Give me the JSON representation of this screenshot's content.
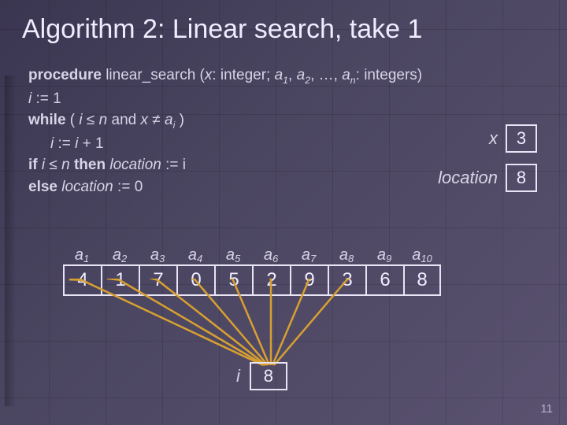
{
  "title": "Algorithm 2: Linear search, take 1",
  "code": {
    "l1_kw": "procedure",
    "l1_rest_a": " linear_search (",
    "l1_x": "x",
    "l1_rest_b": ": integer; ",
    "l1_a": "a",
    "l1_comma": ", ",
    "l1_dots": ", …, ",
    "l1_rest_c": ": integers)",
    "l2_i": "i",
    "l2_assign": " := 1",
    "l3_kw": "while",
    "l3_open": " ( ",
    "l3_i": "i",
    "l3_le": " ≤ ",
    "l3_n": "n",
    "l3_and": " and ",
    "l3_x": "x",
    "l3_ne": " ≠ ",
    "l3_ai": "a",
    "l3_close": " )",
    "l4_i": "i",
    "l4_rest": " := ",
    "l4_i2": "i",
    "l4_plus": " + 1",
    "l5_kw1": "if",
    "l5_i": " i",
    "l5_le": " ≤ ",
    "l5_n": "n",
    "l5_kw2": " then ",
    "l5_loc": "location",
    "l5_rest": " := i",
    "l6_kw": "else",
    "l6_loc": " location",
    "l6_rest": " := 0"
  },
  "right": {
    "x_label": "x",
    "x_value": "3",
    "loc_label": "location",
    "loc_value": "8"
  },
  "array": {
    "labels": [
      "a",
      "a",
      "a",
      "a",
      "a",
      "a",
      "a",
      "a",
      "a",
      "a"
    ],
    "subs": [
      "1",
      "2",
      "3",
      "4",
      "5",
      "6",
      "7",
      "8",
      "9",
      "10"
    ],
    "values": [
      "4",
      "1",
      "7",
      "0",
      "5",
      "2",
      "9",
      "3",
      "6",
      "8"
    ]
  },
  "i_label": "i",
  "i_value": "8",
  "page": "11",
  "chart_data": {
    "type": "table",
    "title": "Linear search trace",
    "array_index": [
      1,
      2,
      3,
      4,
      5,
      6,
      7,
      8,
      9,
      10
    ],
    "array_value": [
      4,
      1,
      7,
      0,
      5,
      2,
      9,
      3,
      6,
      8
    ],
    "x": 3,
    "location": 8,
    "i": 8
  }
}
